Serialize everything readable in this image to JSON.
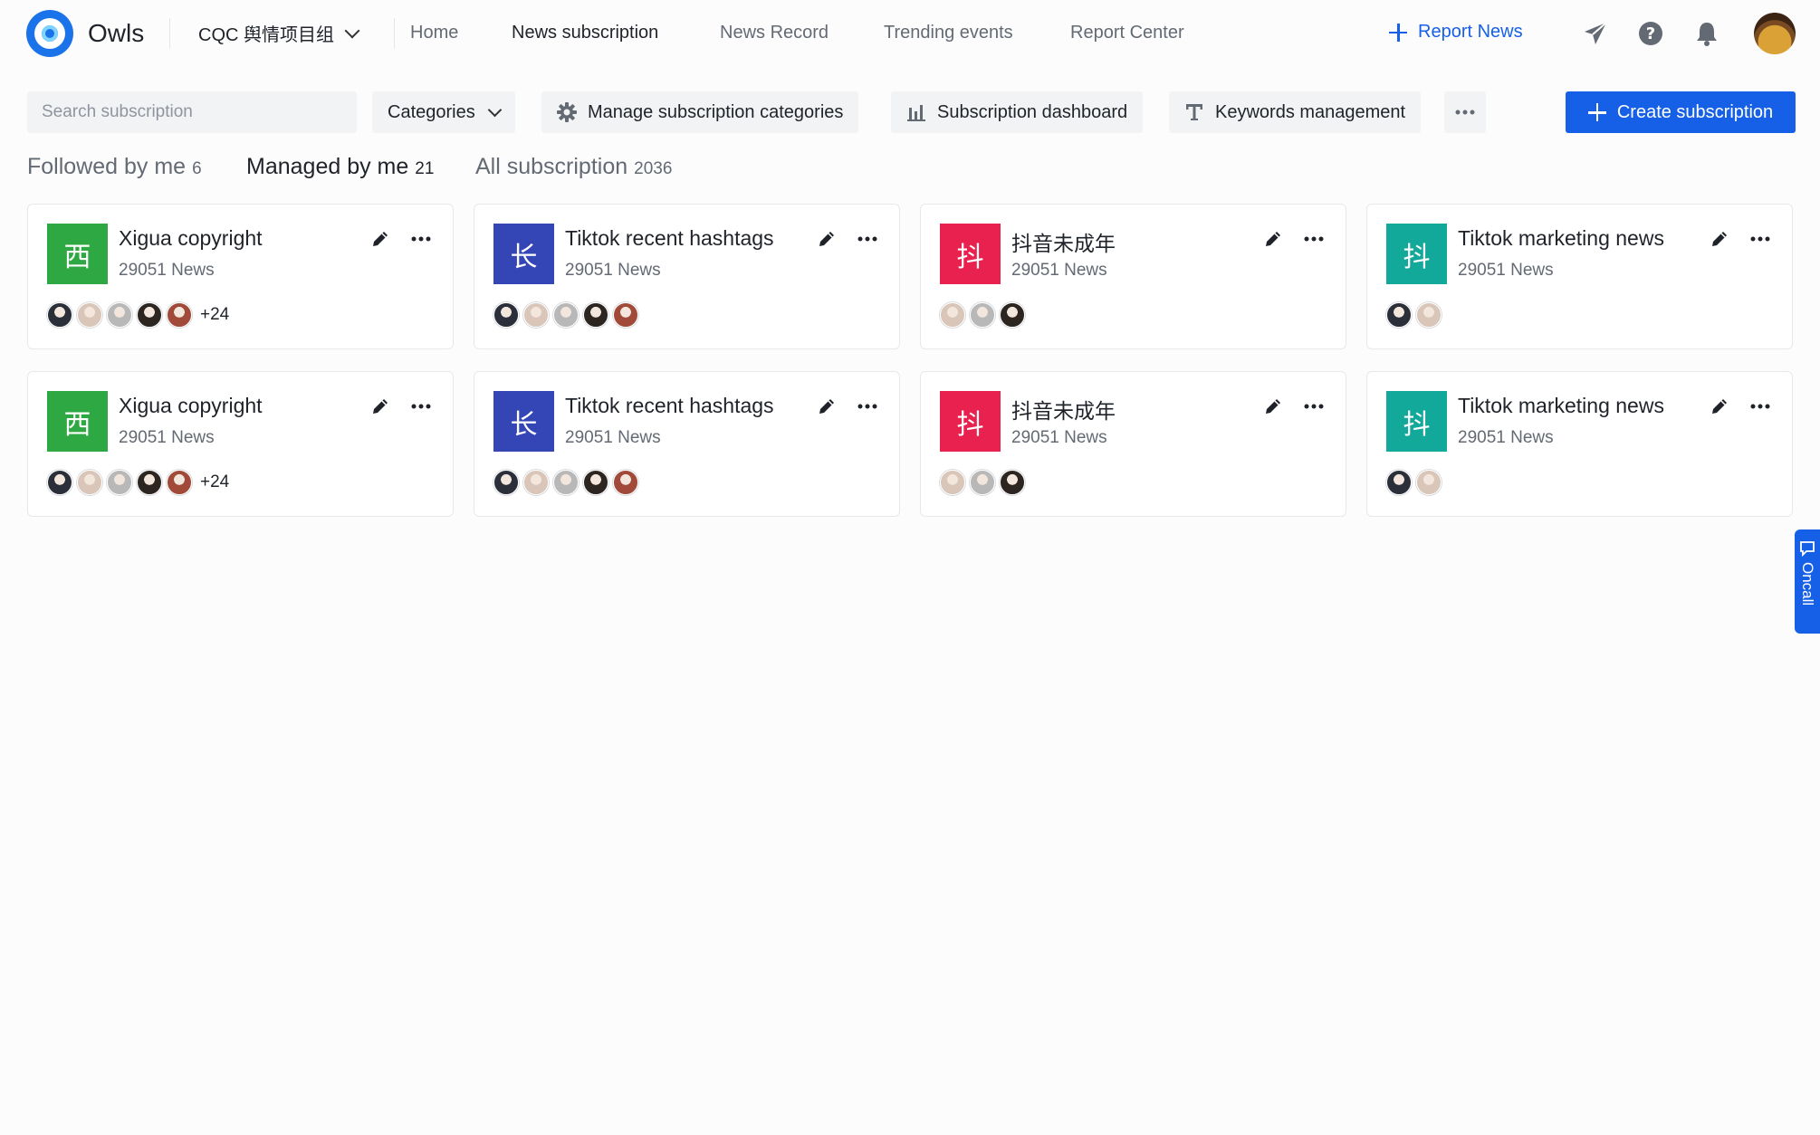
{
  "brand": {
    "name": "Owls"
  },
  "project": {
    "name": "CQC 舆情项目组"
  },
  "nav": [
    {
      "label": "Home",
      "active": false
    },
    {
      "label": "News subscription",
      "active": true
    },
    {
      "label": "News Record",
      "active": false
    },
    {
      "label": "Trending events",
      "active": false
    },
    {
      "label": "Report Center",
      "active": false
    }
  ],
  "header_actions": {
    "report_news": "Report News"
  },
  "toolbar": {
    "search_placeholder": "Search subscription",
    "categories": "Categories",
    "manage_categories": "Manage subscription categories",
    "dashboard": "Subscription dashboard",
    "keywords": "Keywords management",
    "create": "Create subscription"
  },
  "tabs": [
    {
      "label": "Followed by me",
      "count": "6",
      "active": false
    },
    {
      "label": "Managed by me",
      "count": "21",
      "active": true
    },
    {
      "label": "All subscription",
      "count": "2036",
      "active": false
    }
  ],
  "cards": [
    {
      "glyph": "西",
      "color": "#2ea843",
      "title": "Xigua copyright",
      "subtitle": "29051 News",
      "extra": "+24"
    },
    {
      "glyph": "长",
      "color": "#3445b5",
      "title": "Tiktok recent hashtags",
      "subtitle": "29051 News",
      "extra": ""
    },
    {
      "glyph": "抖",
      "color": "#e8214f",
      "title": "抖音未成年",
      "subtitle": "29051 News",
      "extra": ""
    },
    {
      "glyph": "抖",
      "color": "#13a99a",
      "title": "Tiktok marketing news",
      "subtitle": "29051 News",
      "extra": ""
    },
    {
      "glyph": "西",
      "color": "#2ea843",
      "title": "Xigua copyright",
      "subtitle": "29051 News",
      "extra": "+24"
    },
    {
      "glyph": "长",
      "color": "#3445b5",
      "title": "Tiktok recent hashtags",
      "subtitle": "29051 News",
      "extra": ""
    },
    {
      "glyph": "抖",
      "color": "#e8214f",
      "title": "抖音未成年",
      "subtitle": "29051 News",
      "extra": ""
    },
    {
      "glyph": "抖",
      "color": "#13a99a",
      "title": "Tiktok marketing news",
      "subtitle": "29051 News",
      "extra": ""
    }
  ],
  "oncall": {
    "label": "Oncall"
  },
  "colors": {
    "accent": "#1660e8"
  }
}
